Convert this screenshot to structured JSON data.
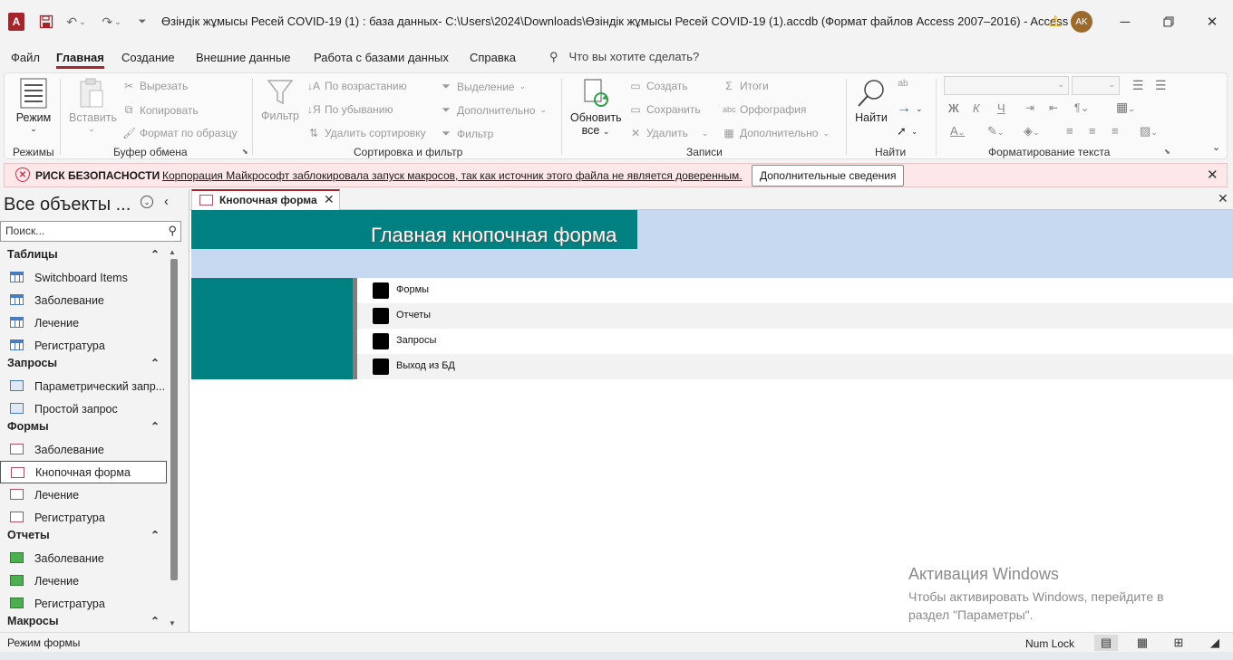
{
  "window": {
    "title": "Өзіндік жұмысы Ресей COVID-19 (1) : база данных- C:\\Users\\2024\\Downloads\\Өзіндік жұмысы Ресей COVID-19 (1).accdb (Формат файлов Access 2007–2016)  -  Access",
    "app_logo": "A",
    "avatar_initials": "AK"
  },
  "menu": {
    "items": [
      "Файл",
      "Главная",
      "Создание",
      "Внешние данные",
      "Работа с базами данных",
      "Справка"
    ],
    "active": "Главная",
    "tellme_placeholder": "Что вы хотите сделать?"
  },
  "ribbon": {
    "groups": {
      "views": "Режимы",
      "clipboard": "Буфер обмена",
      "sort_filter": "Сортировка и фильтр",
      "records": "Записи",
      "find": "Найти",
      "text_format": "Форматирование текста"
    },
    "views": {
      "mode": "Режим"
    },
    "clipboard": {
      "paste": "Вставить",
      "cut": "Вырезать",
      "copy": "Копировать",
      "format_painter": "Формат по образцу"
    },
    "sort_filter": {
      "filter": "Фильтр",
      "ascending": "По возрастанию",
      "descending": "По убыванию",
      "remove_sort": "Удалить сортировку",
      "selection": "Выделение",
      "advanced": "Дополнительно",
      "toggle_filter": "Фильтр"
    },
    "records": {
      "refresh_line1": "Обновить",
      "refresh_line2": "все",
      "new": "Создать",
      "save": "Сохранить",
      "delete": "Удалить",
      "totals": "Итоги",
      "spelling": "Орфография",
      "more": "Дополнительно"
    },
    "find": {
      "find": "Найти"
    },
    "text_format": {
      "bold": "Ж",
      "italic": "К",
      "underline": "Ч"
    }
  },
  "security": {
    "title": "РИСК БЕЗОПАСНОСТИ",
    "message": "Корпорация Майкрософт заблокировала запуск макросов, так как источник этого файла не является доверенным.",
    "more_button": "Дополнительные сведения"
  },
  "nav": {
    "title": "Все объекты ...",
    "search_placeholder": "Поиск...",
    "categories": [
      {
        "label": "Таблицы",
        "items": [
          "Switchboard Items",
          "Заболевание",
          "Лечение",
          "Регистратура"
        ]
      },
      {
        "label": "Запросы",
        "items": [
          "Параметрический запр...",
          "Простой запрос"
        ]
      },
      {
        "label": "Формы",
        "items": [
          "Заболевание",
          "Кнопочная форма",
          "Лечение",
          "Регистратура"
        ]
      },
      {
        "label": "Отчеты",
        "items": [
          "Заболевание",
          "Лечение",
          "Регистратура"
        ]
      },
      {
        "label": "Макросы",
        "items": []
      }
    ],
    "selected": "Кнопочная форма"
  },
  "document": {
    "tab_label": "Кнопочная форма",
    "form_title": "Главная кнопочная форма",
    "switchboard_items": [
      "Формы",
      "Отчеты",
      "Запросы",
      "Выход из БД"
    ]
  },
  "activation": {
    "title": "Активация Windows",
    "subtitle": "Чтобы активировать Windows, перейдите в раздел \"Параметры\"."
  },
  "status": {
    "mode": "Режим формы",
    "numlock": "Num Lock"
  },
  "colors": {
    "accent": "#a4262c",
    "form_teal": "#008080",
    "form_header_band": "#c6d9f1",
    "security_bar": "#fde7e9"
  }
}
